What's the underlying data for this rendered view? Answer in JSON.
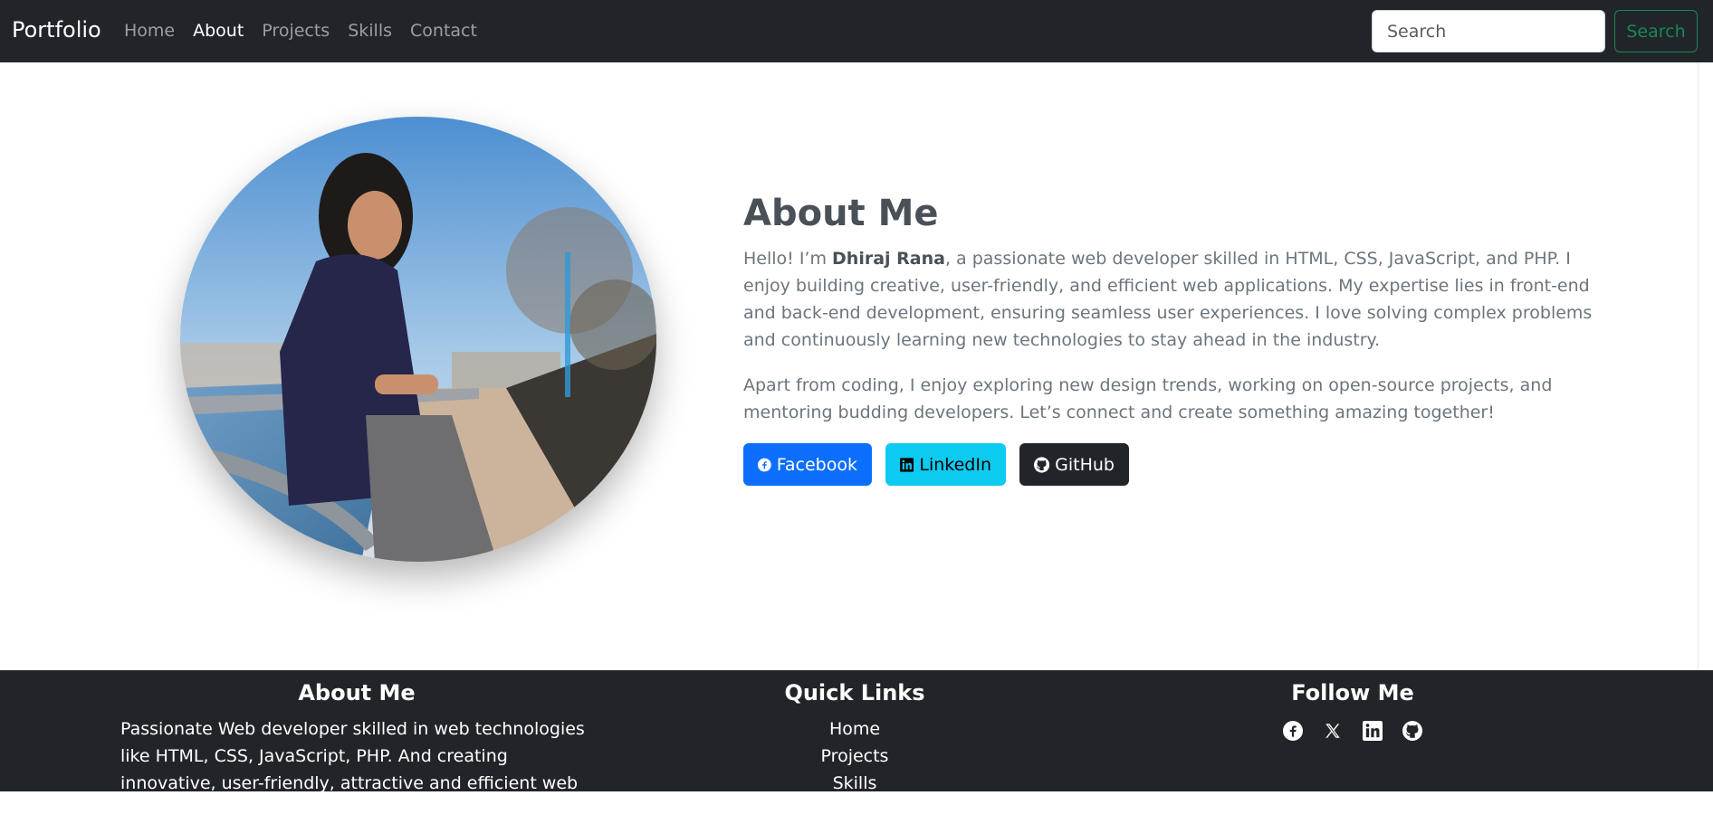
{
  "navbar": {
    "brand": "Portfolio",
    "links": [
      "Home",
      "About",
      "Projects",
      "Skills",
      "Contact"
    ],
    "active": "About",
    "search_placeholder": "Search",
    "search_button": "Search"
  },
  "about": {
    "title": "About Me",
    "para1_prefix": "Hello! I’m ",
    "para1_name": "Dhiraj Rana",
    "para1_rest": ", a passionate web developer skilled in HTML, CSS, JavaScript, and PHP. I enjoy building creative, user-friendly, and efficient web applications. My expertise lies in front-end and back-end development, ensuring seamless user experiences. I love solving complex problems and continuously learning new technologies to stay ahead in the industry.",
    "para2": "Apart from coding, I enjoy exploring new design trends, working on open-source projects, and mentoring budding developers. Let’s connect and create something amazing together!",
    "buttons": {
      "facebook": "Facebook",
      "linkedin": "LinkedIn",
      "github": "GitHub"
    }
  },
  "footer": {
    "about_title": "About Me",
    "about_text": "Passionate Web developer skilled in web technologies like HTML, CSS, JavaScript, PHP. And creating innovative, user-friendly, attractive and efficient web applications.",
    "links_title": "Quick Links",
    "links": [
      "Home",
      "Projects",
      "Skills"
    ],
    "follow_title": "Follow Me",
    "follow_icons": [
      "facebook-icon",
      "x-icon",
      "linkedin-icon",
      "github-icon"
    ]
  },
  "colors": {
    "navbar_bg": "#212529",
    "primary": "#0d6efd",
    "info": "#0dcaf0",
    "success": "#198754"
  }
}
